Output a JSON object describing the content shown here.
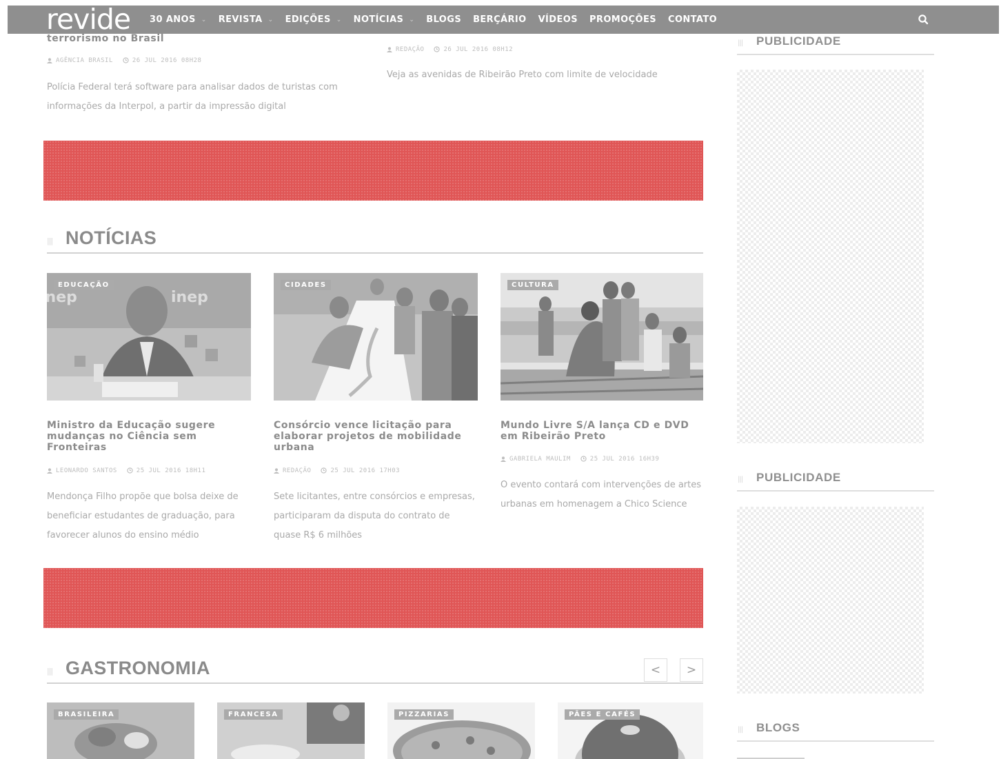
{
  "nav": {
    "logo": "revide",
    "items": [
      {
        "label": "30 ANOS",
        "caret": true
      },
      {
        "label": "REVISTA",
        "caret": true
      },
      {
        "label": "EDIÇÕES",
        "caret": true
      },
      {
        "label": "NOTÍCIAS",
        "caret": true
      },
      {
        "label": "BLOGS",
        "caret": false
      },
      {
        "label": "BERÇÁRIO",
        "caret": false
      },
      {
        "label": "VÍDEOS",
        "caret": false
      },
      {
        "label": "PROMOÇÕES",
        "caret": false
      },
      {
        "label": "CONTATO",
        "caret": false
      }
    ],
    "caret_glyph": "⌄",
    "search_icon": "search-icon"
  },
  "top_articles": [
    {
      "title_tail": "terrorismo no Brasil",
      "author": "AGÊNCIA BRASIL",
      "date": "26 JUL 2016 08H28",
      "excerpt": "Polícia Federal terá software para analisar dados de turistas com informações da Interpol, a partir da impressão digital"
    },
    {
      "author": "REDAÇÃO",
      "date": "26 JUL 2016 08H12",
      "excerpt": "Veja as avenidas de Ribeirão Preto com limite de velocidade"
    }
  ],
  "noticias": {
    "title": "NOTÍCIAS",
    "cards": [
      {
        "tag": "EDUCAÇÃO",
        "title": "Ministro da Educação sugere mudanças no Ciência sem Fronteiras",
        "author": "LEONARDO SANTOS",
        "date": "25 JUL 2016 18H11",
        "excerpt": "Mendonça Filho propõe que bolsa deixe de beneficiar estudantes de graduação, para favorecer alunos do ensino médio"
      },
      {
        "tag": "CIDADES",
        "title": "Consórcio vence licitação para elaborar projetos de mobilidade urbana",
        "author": "REDAÇÃO",
        "date": "25 JUL 2016 17H03",
        "excerpt": "Sete licitantes, entre consórcios e empresas, participaram da disputa do contrato de quase R$ 6 milhões"
      },
      {
        "tag": "CULTURA",
        "title": "Mundo Livre S/A lança CD e DVD em Ribeirão Preto",
        "author": "GABRIELA MAULIM",
        "date": "25 JUL 2016 16H39",
        "excerpt": "O evento contará com intervenções de artes urbanas em homenagem a Chico Science"
      }
    ]
  },
  "gastronomia": {
    "title": "GASTRONOMIA",
    "prev": "<",
    "next": ">",
    "tags": [
      "BRASILEIRA",
      "FRANCESA",
      "PIZZARIAS",
      "PÃES E CAFÉS"
    ]
  },
  "sidebar": {
    "ad_title_1": "PUBLICIDADE",
    "ad_title_2": "PUBLICIDADE",
    "blogs_title": "BLOGS"
  },
  "colors": {
    "ad_banner": "#e05656",
    "navbar": "#8f8f8f"
  }
}
